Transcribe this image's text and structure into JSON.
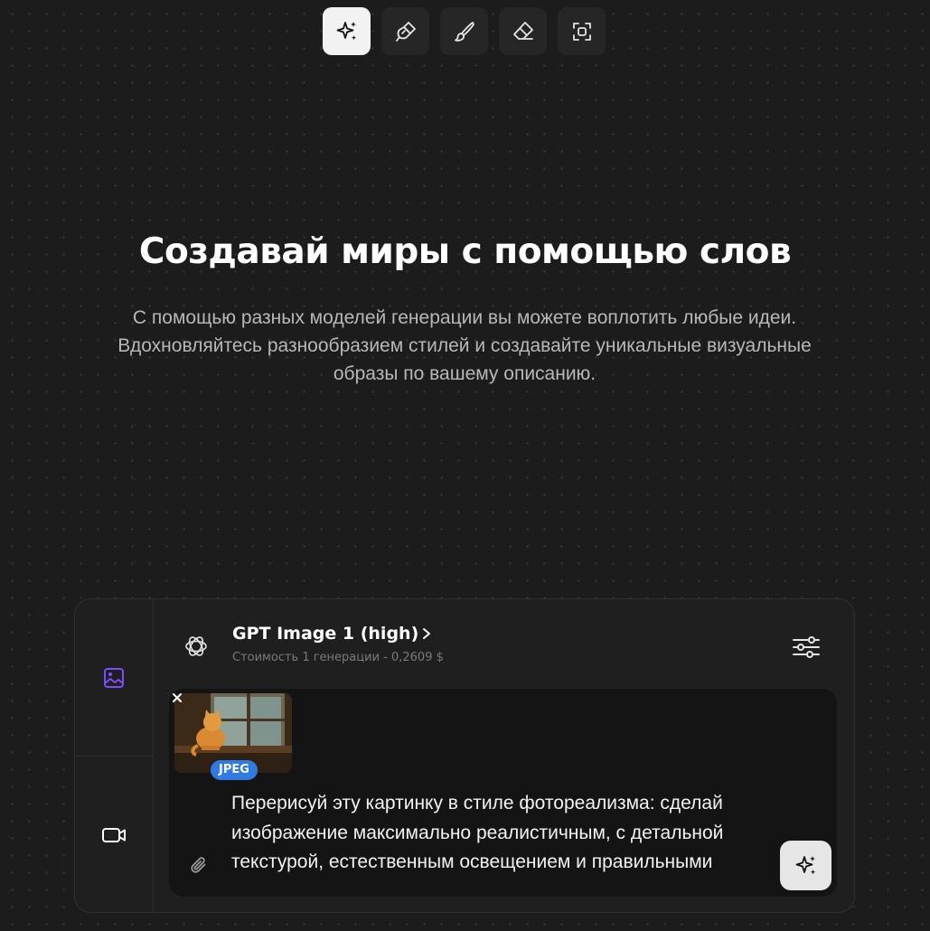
{
  "toolbar": {
    "tools": [
      {
        "icon": "sparkles-icon",
        "active": true
      },
      {
        "icon": "brush-icon",
        "active": false
      },
      {
        "icon": "paintbrush-icon",
        "active": false
      },
      {
        "icon": "eraser-icon",
        "active": false
      },
      {
        "icon": "scan-icon",
        "active": false
      }
    ]
  },
  "hero": {
    "title": "Создавай миры с помощью слов",
    "description": "С помощью разных моделей генерации вы можете воплотить любые идеи. Вдохновляйтесь разнообразием стилей и создавайте уникальные визуальные образы по вашему описанию."
  },
  "composer": {
    "sidebar": {
      "tabs": [
        {
          "icon": "image-icon",
          "active": true,
          "color": "#7c4dff"
        },
        {
          "icon": "video-icon",
          "active": false,
          "color": "#ffffff"
        }
      ]
    },
    "model": {
      "name": "GPT Image 1 (high)",
      "cost": "Стоимость 1 генерации - 0,2609 $",
      "icon": "openai-logo-icon"
    },
    "attachment": {
      "format": "JPEG"
    },
    "prompt": "Перерисуй эту картинку в стиле фотореализма: сделай изображение максимально реалистичным, с детальной текстурой, естественным освещением и правильными"
  },
  "colors": {
    "background": "#1c1c1c",
    "accent": "#7c4dff",
    "badge": "#2f7be3"
  }
}
